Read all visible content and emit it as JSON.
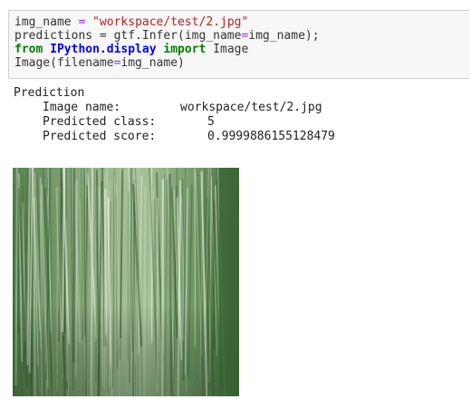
{
  "code_cell": {
    "line1": {
      "var": "img_name",
      "eq": " = ",
      "str": "\"workspace/test/2.jpg\""
    },
    "line2": {
      "text": "predictions = gtf.Infer(img_name",
      "eq": "=",
      "rest": "img_name);"
    },
    "line3": {
      "from": "from",
      "module": "IPython.display",
      "import": "import",
      "name": "Image"
    },
    "line4": {
      "text": "Image(filename",
      "eq": "=",
      "rest": "img_name)"
    }
  },
  "output": {
    "heading": "Prediction",
    "image_name_label": "Image name:",
    "image_name_value": "workspace/test/2.jpg",
    "predicted_class_label": "Predicted class:",
    "predicted_class_value": "5",
    "predicted_score_label": "Predicted score:",
    "predicted_score_value": "0.9999886155128479"
  },
  "image": {
    "description_icon": "plant-leaf-image",
    "base_color": "#3f6a3a",
    "highlight_color": "#d8e6cf"
  }
}
